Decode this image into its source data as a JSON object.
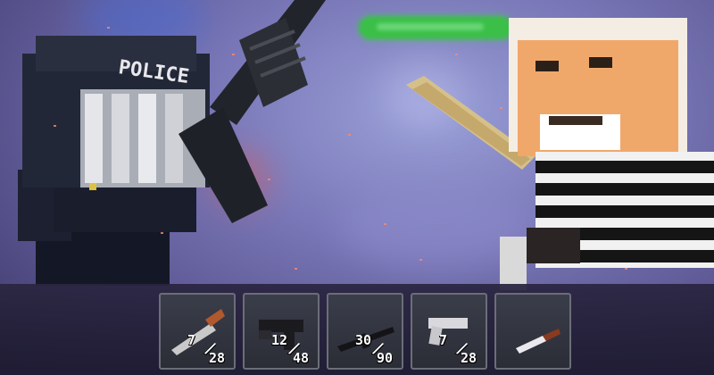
{
  "scene": {
    "colors": {
      "sky": "#7a78b8",
      "health": "#3bbf48",
      "slot_border": "#6b6e78"
    },
    "police_vest_text": "POLICE",
    "health_bar": {
      "level": 1.0
    }
  },
  "hotbar": {
    "slots": [
      {
        "weapon_icon": "shotgun-icon",
        "clip": "7",
        "reserve": "28"
      },
      {
        "weapon_icon": "smg-icon",
        "clip": "12",
        "reserve": "48"
      },
      {
        "weapon_icon": "rifle-icon",
        "clip": "30",
        "reserve": "90"
      },
      {
        "weapon_icon": "pistol-icon",
        "clip": "7",
        "reserve": "28"
      },
      {
        "weapon_icon": "knife-icon"
      }
    ]
  }
}
